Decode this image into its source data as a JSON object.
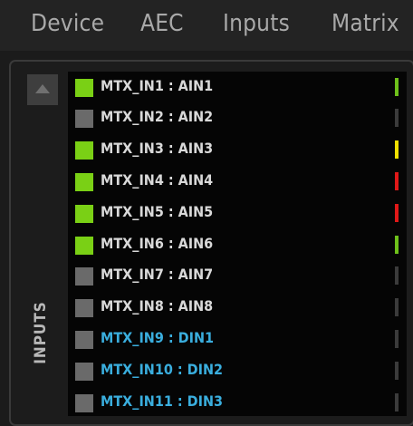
{
  "tabs": [
    {
      "label": "Device"
    },
    {
      "label": "AEC"
    },
    {
      "label": "Inputs"
    },
    {
      "label": "Matrix"
    }
  ],
  "panel": {
    "side_label": "INPUTS",
    "colors": {
      "active_square": "#7ad015",
      "inactive_square": "#6a6a6a",
      "analog_text": "#d9d9d9",
      "digital_text": "#3aaede",
      "meter_idle": "#3b3b3b",
      "meter_green": "#6ec01a",
      "meter_yellow": "#f0e000",
      "meter_red": "#e01818"
    },
    "inputs": [
      {
        "label": "MTX_IN1 : AIN1",
        "enabled": true,
        "kind": "analog",
        "meter": "green"
      },
      {
        "label": "MTX_IN2 : AIN2",
        "enabled": false,
        "kind": "analog",
        "meter": "idle"
      },
      {
        "label": "MTX_IN3 : AIN3",
        "enabled": true,
        "kind": "analog",
        "meter": "yellow"
      },
      {
        "label": "MTX_IN4 : AIN4",
        "enabled": true,
        "kind": "analog",
        "meter": "red"
      },
      {
        "label": "MTX_IN5 : AIN5",
        "enabled": true,
        "kind": "analog",
        "meter": "red"
      },
      {
        "label": "MTX_IN6 : AIN6",
        "enabled": true,
        "kind": "analog",
        "meter": "green"
      },
      {
        "label": "MTX_IN7 : AIN7",
        "enabled": false,
        "kind": "analog",
        "meter": "idle"
      },
      {
        "label": "MTX_IN8 : AIN8",
        "enabled": false,
        "kind": "analog",
        "meter": "idle"
      },
      {
        "label": "MTX_IN9 : DIN1",
        "enabled": false,
        "kind": "digital",
        "meter": "idle"
      },
      {
        "label": "MTX_IN10 : DIN2",
        "enabled": false,
        "kind": "digital",
        "meter": "idle"
      },
      {
        "label": "MTX_IN11 : DIN3",
        "enabled": false,
        "kind": "digital",
        "meter": "idle"
      }
    ]
  }
}
